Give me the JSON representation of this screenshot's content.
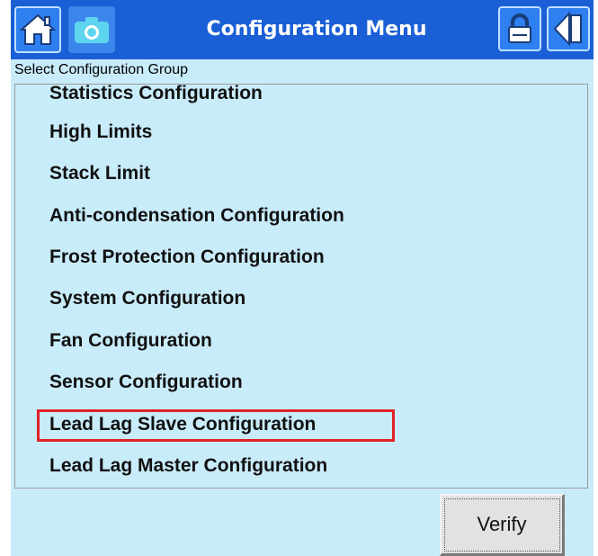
{
  "header": {
    "title": "Configuration Menu",
    "buttons": {
      "home_icon": "home-icon",
      "camera_icon": "camera-icon",
      "lock_icon": "lock-icon",
      "back_icon": "back-arrow-icon"
    }
  },
  "group_label": "Select Configuration Group",
  "config_items": [
    {
      "label": "Statistics Configuration",
      "partially_visible": true
    },
    {
      "label": "High Limits"
    },
    {
      "label": "Stack Limit"
    },
    {
      "label": "Anti-condensation Configuration"
    },
    {
      "label": "Frost Protection Configuration"
    },
    {
      "label": "System Configuration"
    },
    {
      "label": "Fan Configuration"
    },
    {
      "label": "Sensor Configuration"
    },
    {
      "label": "Lead Lag Slave Configuration",
      "highlighted": true
    },
    {
      "label": "Lead Lag Master Configuration"
    }
  ],
  "verify_label": "Verify",
  "colors": {
    "titlebar": "#1a5fd6",
    "background": "#c9ecfa",
    "highlight": "#e0212a"
  }
}
